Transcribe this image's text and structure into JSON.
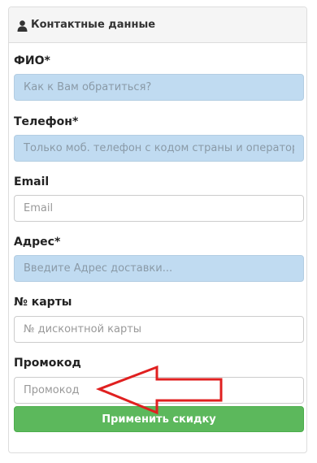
{
  "panel": {
    "title": "Контактные данные",
    "icon": "user-icon"
  },
  "fields": [
    {
      "label": "ФИО*",
      "placeholder": "Как к Вам обратиться?",
      "value": ""
    },
    {
      "label": "Телефон*",
      "placeholder": "Только моб. телефон с кодом страны и оператора",
      "value": ""
    },
    {
      "label": "Email",
      "placeholder": "Email",
      "value": ""
    },
    {
      "label": "Адрес*",
      "placeholder": "Введите Адрес доставки...",
      "value": ""
    },
    {
      "label": "№ карты",
      "placeholder": "№ дисконтной карты",
      "value": ""
    },
    {
      "label": "Промокод",
      "placeholder": "Промокод",
      "value": ""
    }
  ],
  "apply_button": {
    "label": "Применить скидку"
  },
  "colors": {
    "autofill_background": "#c0dbf1",
    "button_green": "#5cb85c",
    "arrow_red": "#e02020"
  }
}
